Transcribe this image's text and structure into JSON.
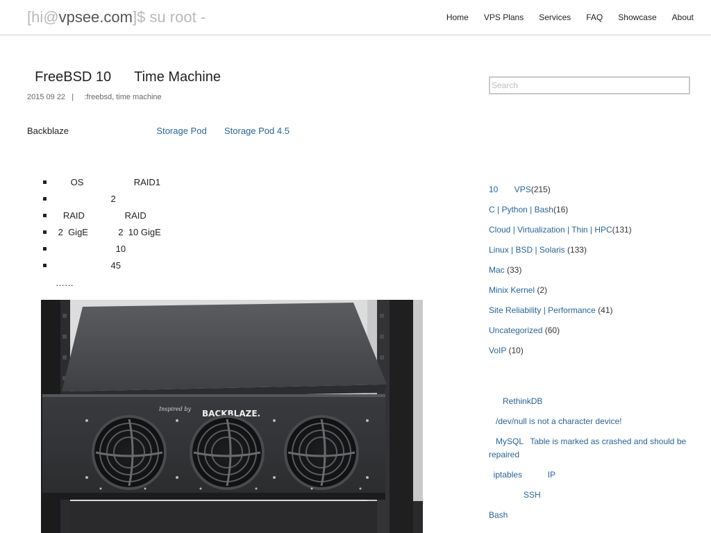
{
  "header": {
    "title_prefix": "[hi@",
    "title_host": "vpsee.com",
    "title_suffix": "]$ su root -",
    "nav": [
      "Home",
      "VPS Plans",
      "Services",
      "FAQ",
      "Showcase",
      "About"
    ]
  },
  "post": {
    "title": "  FreeBSD 10      Time Machine",
    "meta": "2015 09 22   |     :freebsd, time machine",
    "intro_prefix": "Backblaze                                   ",
    "link_storage_pod": "Storage Pod",
    "intro_gap": "       ",
    "link_storage_pod_45": "Storage Pod 4.5",
    "features": [
      "      OS                    RAID1",
      "                      2",
      "   RAID                RAID",
      " 2  GigE            2  10 GigE",
      "                        10",
      "                      45"
    ],
    "ellipsis": "……"
  },
  "sidebar": {
    "search_placeholder": "Search",
    "categories": [
      {
        "name": "10       VPS",
        "count": "(215)"
      },
      {
        "name": "C | Python | Bash",
        "count": "(16)"
      },
      {
        "name": "Cloud | Virtualization | Thin | HPC",
        "count": "(131)"
      },
      {
        "name": "Linux | BSD | Solaris",
        "count": " (133)"
      },
      {
        "name": "Mac",
        "count": " (33)"
      },
      {
        "name": "Minix Kernel",
        "count": " (2)"
      },
      {
        "name": "Site Reliability | Performance",
        "count": " (41)"
      },
      {
        "name": "Uncategorized",
        "count": " (60)"
      },
      {
        "name": "VoIP",
        "count": " (10)"
      }
    ],
    "recent_posts": [
      "      RethinkDB",
      "   /dev/null is not a character device!",
      "   MySQL   Table is marked as crashed and should be repaired",
      "  iptables           IP",
      "               SSH",
      "Bash"
    ]
  },
  "photo": {
    "brand_inspired": "Inspired by",
    "brand_name": "BACKBLAZE."
  }
}
